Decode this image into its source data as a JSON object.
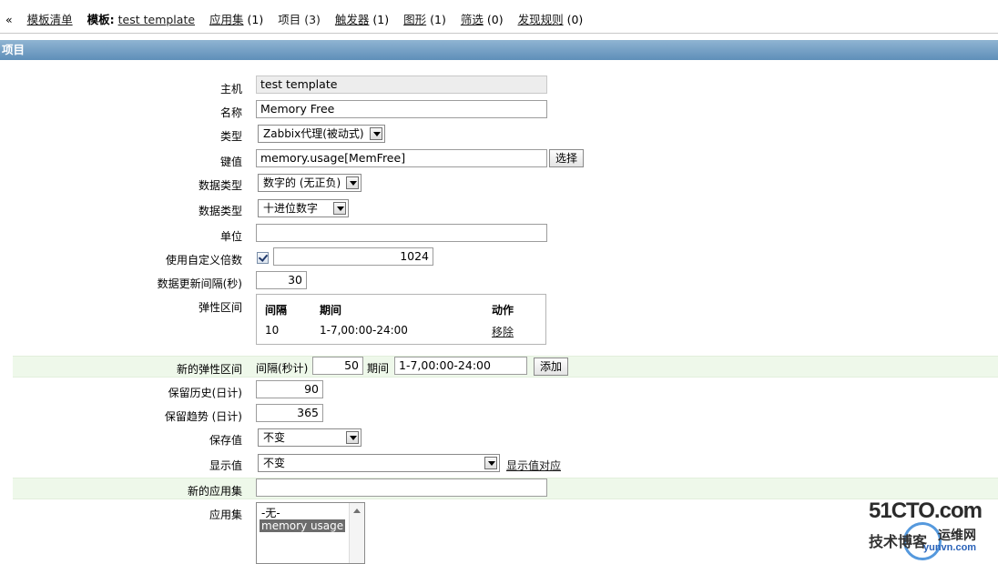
{
  "breadcrumb": {
    "back_label": "« ",
    "template_list": "模板清单",
    "template_prefix": "模板:",
    "template_name": "test template",
    "applications": "应用集",
    "applications_count": "(1)",
    "items": "项目 (3)",
    "triggers": "触发器",
    "triggers_count": "(1)",
    "graphs": "图形",
    "graphs_count": "(1)",
    "screens": "筛选",
    "screens_count": "(0)",
    "discovery": "发现规则",
    "discovery_count": "(0)"
  },
  "section_title": "项目",
  "form": {
    "host_label": "主机",
    "host_value": "test template",
    "name_label": "名称",
    "name_value": "Memory Free",
    "type_label": "类型",
    "type_value": "Zabbix代理(被动式)",
    "key_label": "键值",
    "key_value": "memory.usage[MemFree]",
    "key_select_button": "选择",
    "value_type_label": "数据类型",
    "value_type_value": "数字的 (无正负)",
    "data_type_label": "数据类型",
    "data_type_value": "十进位数字",
    "units_label": "单位",
    "units_value": "",
    "multiplier_label": "使用自定义倍数",
    "multiplier_value": "1024",
    "interval_label": "数据更新间隔(秒)",
    "interval_value": "30",
    "flex_label": "弹性区间",
    "flex_headers": {
      "interval": "间隔",
      "period": "期间",
      "action": "动作"
    },
    "flex_rows": [
      {
        "interval": "10",
        "period": "1-7,00:00-24:00",
        "action": "移除"
      }
    ],
    "new_flex_label": "新的弹性区间",
    "new_flex_interval_label": "间隔(秒计)",
    "new_flex_interval_value": "50",
    "new_flex_period_label": "期间",
    "new_flex_period_value": "1-7,00:00-24:00",
    "new_flex_add_button": "添加",
    "history_label": "保留历史(日计)",
    "history_value": "90",
    "trends_label": "保留趋势 (日计)",
    "trends_value": "365",
    "store_label": "保存值",
    "store_value": "不变",
    "show_label": "显示值",
    "show_value": "不变",
    "show_mapping_link": "显示值对应",
    "new_app_label": "新的应用集",
    "new_app_value": "",
    "apps_label": "应用集",
    "apps_options": [
      "-无-",
      "memory usage"
    ]
  },
  "watermark": {
    "brand": "51CTO.com",
    "tagline": "技术博客",
    "site_cn": "运维网",
    "site_url": "yunvn.com"
  }
}
